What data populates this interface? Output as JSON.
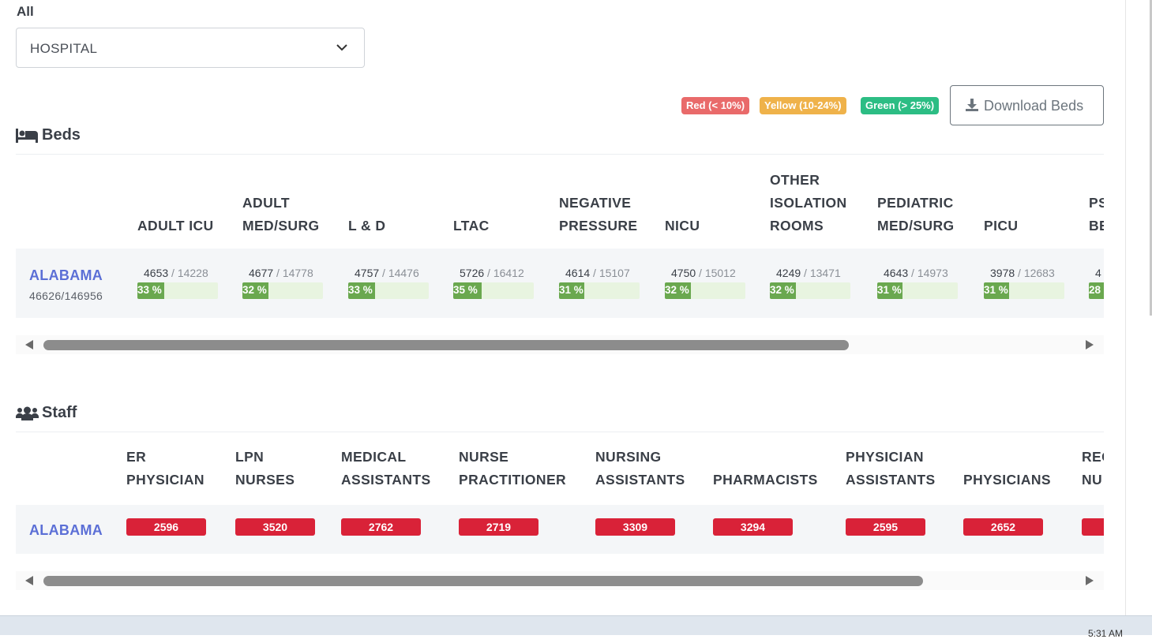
{
  "filter": {
    "label": "All",
    "selected": "HOSPITAL"
  },
  "legend": {
    "red": "Red (< 10%)",
    "yellow": "Yellow (10-24%)",
    "green": "Green (> 25%)"
  },
  "download_button": "Download Beds",
  "beds": {
    "title": "Beds",
    "columns": [
      [
        "ADULT ICU"
      ],
      [
        "ADULT",
        "MED/SURG"
      ],
      [
        "L & D"
      ],
      [
        "LTAC"
      ],
      [
        "NEGATIVE",
        "PRESSURE"
      ],
      [
        "NICU"
      ],
      [
        "OTHER",
        "ISOLATION",
        "ROOMS"
      ],
      [
        "PEDIATRIC",
        "MED/SURG"
      ],
      [
        "PICU"
      ],
      [
        "PS",
        "BE"
      ]
    ],
    "row": {
      "state": "ALABAMA",
      "summary": "46626/146956",
      "cells": [
        {
          "available": "4653",
          "total": "14228",
          "pct": "33 %",
          "pct_value": 33
        },
        {
          "available": "4677",
          "total": "14778",
          "pct": "32 %",
          "pct_value": 32
        },
        {
          "available": "4757",
          "total": "14476",
          "pct": "33 %",
          "pct_value": 33
        },
        {
          "available": "5726",
          "total": "16412",
          "pct": "35 %",
          "pct_value": 35
        },
        {
          "available": "4614",
          "total": "15107",
          "pct": "31 %",
          "pct_value": 31
        },
        {
          "available": "4750",
          "total": "15012",
          "pct": "32 %",
          "pct_value": 32
        },
        {
          "available": "4249",
          "total": "13471",
          "pct": "32 %",
          "pct_value": 32
        },
        {
          "available": "4643",
          "total": "14973",
          "pct": "31 %",
          "pct_value": 31
        },
        {
          "available": "3978",
          "total": "12683",
          "pct": "31 %",
          "pct_value": 31
        },
        {
          "available": "4",
          "total": "",
          "pct": "28",
          "pct_value": 28
        }
      ]
    }
  },
  "staff": {
    "title": "Staff",
    "columns": [
      [
        "ER",
        "PHYSICIAN"
      ],
      [
        "LPN",
        "NURSES"
      ],
      [
        "MEDICAL",
        "ASSISTANTS"
      ],
      [
        "NURSE",
        "PRACTITIONER"
      ],
      [
        "NURSING",
        "ASSISTANTS"
      ],
      [
        "PHARMACISTS"
      ],
      [
        "PHYSICIAN",
        "ASSISTANTS"
      ],
      [
        "PHYSICIANS"
      ],
      [
        "REG",
        "NU"
      ]
    ],
    "row": {
      "state": "ALABAMA",
      "values": [
        "2596",
        "3520",
        "2762",
        "2719",
        "3309",
        "3294",
        "2595",
        "2652",
        ""
      ]
    }
  },
  "taskbar": {
    "clock": "5:31 AM"
  },
  "colors": {
    "red": "#e96a6a",
    "yellow": "#efb24a",
    "green": "#2cbd84",
    "bar": "#6aa84f",
    "staff_badge": "#d92238",
    "link": "#5b6fd6"
  }
}
